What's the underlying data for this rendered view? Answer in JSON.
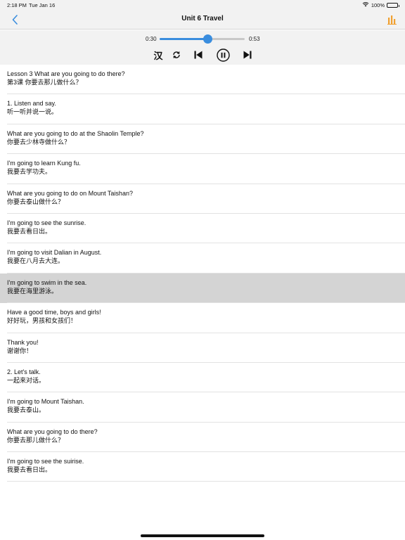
{
  "status": {
    "time": "2:18 PM",
    "date": "Tue Jan 16",
    "battery": "100%",
    "icons": [
      "wifi-icon",
      "battery-icon"
    ]
  },
  "nav": {
    "title": "Unit 6 Travel",
    "back_icon": "chevron-left-icon",
    "right_icon": "bar-chart-icon",
    "accent": "#3a8dde",
    "chart_icon_color": "#f0a030"
  },
  "player": {
    "current_time": "0:30",
    "total_time": "0:53",
    "progress": 0.566,
    "han_label": "汉",
    "icons": [
      "repeat-icon",
      "skip-previous-icon",
      "pause-icon",
      "skip-next-icon"
    ]
  },
  "sentences": [
    {
      "en": "Lesson 3 What are you going to do there?",
      "zh": "第3课 你要去那儿做什么？",
      "active": false
    },
    {
      "en": "1. Listen and say.",
      "zh": "听一听并说一说。",
      "active": false
    },
    {
      "en": "What are you going to do at the Shaolin Temple?",
      "zh": "你要去少林寺做什么？",
      "active": false
    },
    {
      "en": "I'm going to learn Kung fu.",
      "zh": "我要去学功夫。",
      "active": false
    },
    {
      "en": "What are you going to do on Mount Taishan?",
      "zh": "你要去泰山做什么？",
      "active": false
    },
    {
      "en": "I'm going to see the sunrise.",
      "zh": "我要去看日出。",
      "active": false
    },
    {
      "en": "I'm going to visit Dalian in August.",
      "zh": "我要在八月去大连。",
      "active": false
    },
    {
      "en": "I'm going to swim in the sea.",
      "zh": "我要在海里游泳。",
      "active": true
    },
    {
      "en": "Have a good time, boys and girls!",
      "zh": "好好玩，男孩和女孩们！",
      "active": false
    },
    {
      "en": "Thank you!",
      "zh": "谢谢你！",
      "active": false
    },
    {
      "en": "2. Let's talk.",
      "zh": "一起来对话。",
      "active": false
    },
    {
      "en": "I'm going to Mount Taishan.",
      "zh": "我要去泰山。",
      "active": false
    },
    {
      "en": "What are you going to do there?",
      "zh": "你要去那儿做什么？",
      "active": false
    },
    {
      "en": "I'm going to see the suirise.",
      "zh": "我要去看日出。",
      "active": false
    }
  ]
}
